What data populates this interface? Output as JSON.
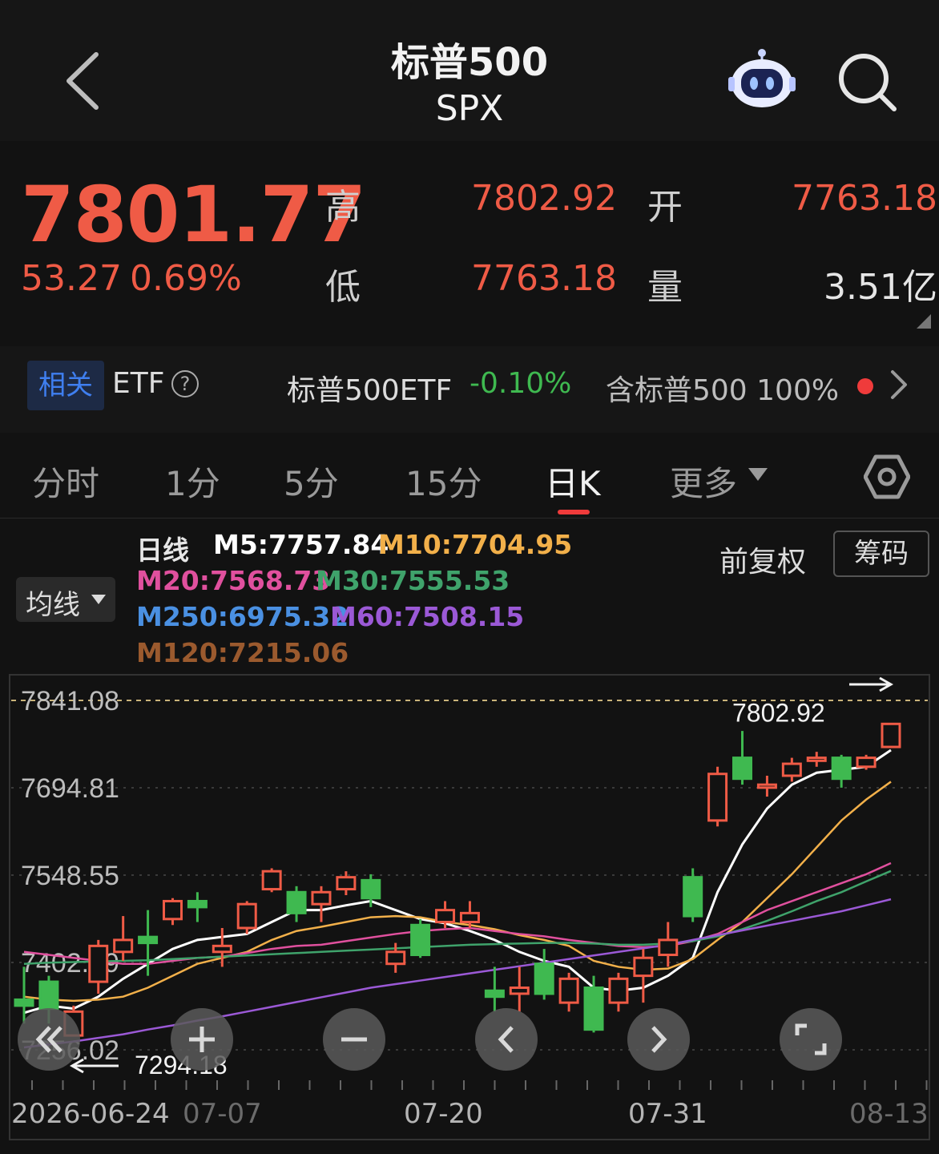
{
  "header": {
    "title": "标普500",
    "subtitle": "SPX"
  },
  "quote": {
    "price": "7801.77",
    "change": "53.27",
    "change_pct": "0.69%",
    "high_label": "高",
    "high": "7802.92",
    "open_label": "开",
    "open": "7763.18",
    "low_label": "低",
    "low": "7763.18",
    "volume_label": "量",
    "volume": "3.51亿"
  },
  "etf": {
    "badge": "相关",
    "label": "ETF",
    "help": "?",
    "name": "标普500ETF",
    "change": "-0.10%",
    "contains": "含标普500 100%"
  },
  "tabs": [
    "分时",
    "1分",
    "5分",
    "15分",
    "日K",
    "更多"
  ],
  "legend": {
    "period": "日线",
    "m5": "M5:7757.84",
    "m10": "M10:7704.95",
    "m20": "M20:7568.73",
    "m30": "M30:7555.53",
    "m250": "M250:6975.32",
    "m60": "M60:7508.15",
    "m120": "M120:7215.06",
    "ma_select": "均线",
    "adjust": "前复权",
    "chip": "筹码"
  },
  "colors": {
    "up": "#ef5b46",
    "down": "#3fb950",
    "m5": "#ffffff",
    "m10": "#f2b04a",
    "m20": "#e0509e",
    "m30": "#3fa36b",
    "m60": "#9b59d6",
    "m120": "#9b5a2e",
    "m250": "#4a90e2"
  },
  "chart_data": {
    "type": "candlestick",
    "y_ticks": [
      "7841.08",
      "7694.81",
      "7548.55",
      "7402.29",
      "7256.02"
    ],
    "ylim": [
      7256.02,
      7841.08
    ],
    "x_labels": [
      "2026-06-24",
      "07-07",
      "07-20",
      "07-31",
      "08-13"
    ],
    "high_marker": "7802.92",
    "low_marker": "7294.18",
    "candles": [
      {
        "o": 7340,
        "c": 7330,
        "h": 7395,
        "l": 7300
      },
      {
        "o": 7370,
        "c": 7325,
        "h": 7380,
        "l": 7300
      },
      {
        "o": 7280,
        "c": 7320,
        "h": 7330,
        "l": 7294.18
      },
      {
        "o": 7370,
        "c": 7430,
        "h": 7440,
        "l": 7350
      },
      {
        "o": 7420,
        "c": 7440,
        "h": 7480,
        "l": 7405
      },
      {
        "o": 7445,
        "c": 7435,
        "h": 7490,
        "l": 7380
      },
      {
        "o": 7475,
        "c": 7505,
        "h": 7510,
        "l": 7465
      },
      {
        "o": 7505,
        "c": 7495,
        "h": 7520,
        "l": 7470
      },
      {
        "o": 7420,
        "c": 7430,
        "h": 7460,
        "l": 7395
      },
      {
        "o": 7460,
        "c": 7500,
        "h": 7505,
        "l": 7450
      },
      {
        "o": 7525,
        "c": 7555,
        "h": 7560,
        "l": 7520
      },
      {
        "o": 7520,
        "c": 7485,
        "h": 7530,
        "l": 7470
      },
      {
        "o": 7500,
        "c": 7520,
        "h": 7530,
        "l": 7470
      },
      {
        "o": 7525,
        "c": 7545,
        "h": 7555,
        "l": 7515
      },
      {
        "o": 7540,
        "c": 7510,
        "h": 7550,
        "l": 7495
      },
      {
        "o": 7400,
        "c": 7420,
        "h": 7435,
        "l": 7385
      },
      {
        "o": 7465,
        "c": 7415,
        "h": 7475,
        "l": 7410
      },
      {
        "o": 7470,
        "c": 7490,
        "h": 7505,
        "l": 7460
      },
      {
        "o": 7470,
        "c": 7485,
        "h": 7505,
        "l": 7460
      },
      {
        "o": 7355,
        "c": 7345,
        "h": 7395,
        "l": 7320
      },
      {
        "o": 7350,
        "c": 7360,
        "h": 7395,
        "l": 7320
      },
      {
        "o": 7400,
        "c": 7350,
        "h": 7425,
        "l": 7340
      },
      {
        "o": 7335,
        "c": 7375,
        "h": 7385,
        "l": 7320
      },
      {
        "o": 7360,
        "c": 7290,
        "h": 7380,
        "l": 7285
      },
      {
        "o": 7335,
        "c": 7375,
        "h": 7385,
        "l": 7320
      },
      {
        "o": 7380,
        "c": 7410,
        "h": 7425,
        "l": 7335
      },
      {
        "o": 7415,
        "c": 7440,
        "h": 7470,
        "l": 7395
      },
      {
        "o": 7545,
        "c": 7480,
        "h": 7560,
        "l": 7470
      },
      {
        "o": 7640,
        "c": 7718,
        "h": 7730,
        "l": 7630
      },
      {
        "o": 7745,
        "c": 7710,
        "h": 7790,
        "l": 7700
      },
      {
        "o": 7695,
        "c": 7700,
        "h": 7715,
        "l": 7680
      },
      {
        "o": 7715,
        "c": 7735,
        "h": 7745,
        "l": 7705
      },
      {
        "o": 7740,
        "c": 7745,
        "h": 7755,
        "l": 7730
      },
      {
        "o": 7745,
        "c": 7710,
        "h": 7750,
        "l": 7695
      },
      {
        "o": 7730,
        "c": 7745,
        "h": 7750,
        "l": 7725
      },
      {
        "o": 7763.18,
        "c": 7801.77,
        "h": 7802.92,
        "l": 7763.18
      }
    ],
    "series": [
      {
        "name": "M5",
        "values": [
          7318,
          7330,
          7325,
          7345,
          7375,
          7400,
          7425,
          7440,
          7445,
          7450,
          7470,
          7490,
          7490,
          7498,
          7505,
          7490,
          7475,
          7468,
          7455,
          7440,
          7420,
          7405,
          7395,
          7360,
          7355,
          7360,
          7380,
          7410,
          7520,
          7600,
          7660,
          7700,
          7720,
          7725,
          7730,
          7757.84
        ]
      },
      {
        "name": "M10",
        "values": [
          7345,
          7340,
          7338,
          7340,
          7345,
          7360,
          7380,
          7400,
          7410,
          7420,
          7440,
          7455,
          7462,
          7470,
          7478,
          7480,
          7478,
          7470,
          7465,
          7458,
          7448,
          7440,
          7430,
          7405,
          7395,
          7390,
          7392,
          7408,
          7440,
          7470,
          7510,
          7550,
          7595,
          7640,
          7675,
          7704.95
        ]
      },
      {
        "name": "M20",
        "values": [
          7420,
          7415,
          7410,
          7405,
          7400,
          7400,
          7405,
          7410,
          7412,
          7418,
          7425,
          7430,
          7432,
          7438,
          7444,
          7450,
          7455,
          7458,
          7460,
          7455,
          7450,
          7446,
          7440,
          7435,
          7430,
          7428,
          7430,
          7438,
          7450,
          7470,
          7490,
          7505,
          7520,
          7535,
          7550,
          7568.73
        ]
      },
      {
        "name": "M30",
        "values": [
          7400,
          7402,
          7403,
          7404,
          7405,
          7406,
          7408,
          7410,
          7412,
          7414,
          7416,
          7418,
          7420,
          7422,
          7424,
          7426,
          7428,
          7430,
          7432,
          7433,
          7434,
          7435,
          7435,
          7434,
          7432,
          7432,
          7434,
          7438,
          7446,
          7458,
          7472,
          7488,
          7505,
          7520,
          7538,
          7555.53
        ]
      },
      {
        "name": "M60",
        "values": [
          7260,
          7265,
          7270,
          7276,
          7282,
          7290,
          7297,
          7305,
          7312,
          7320,
          7328,
          7336,
          7344,
          7352,
          7360,
          7366,
          7372,
          7378,
          7384,
          7390,
          7396,
          7402,
          7408,
          7414,
          7420,
          7426,
          7432,
          7440,
          7448,
          7456,
          7464,
          7472,
          7480,
          7488,
          7498,
          7508.15
        ]
      }
    ],
    "grid": true
  }
}
